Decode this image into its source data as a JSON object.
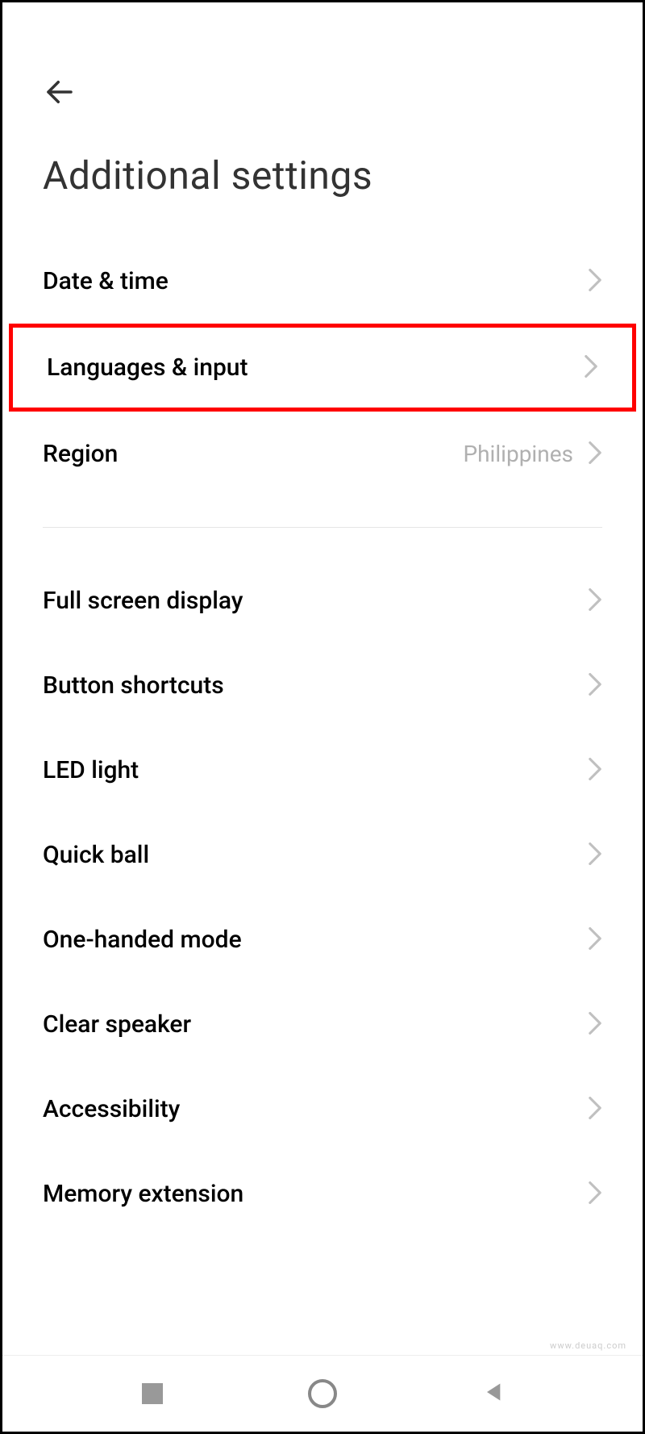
{
  "header": {
    "title": "Additional settings"
  },
  "items": [
    {
      "label": "Date & time",
      "value": "",
      "highlighted": false
    },
    {
      "label": "Languages & input",
      "value": "",
      "highlighted": true
    },
    {
      "label": "Region",
      "value": "Philippines",
      "highlighted": false
    }
  ],
  "items2": [
    {
      "label": "Full screen display"
    },
    {
      "label": "Button shortcuts"
    },
    {
      "label": "LED light"
    },
    {
      "label": "Quick ball"
    },
    {
      "label": "One-handed mode"
    },
    {
      "label": "Clear speaker"
    },
    {
      "label": "Accessibility"
    },
    {
      "label": "Memory extension"
    }
  ],
  "watermark": "www.deuaq.com"
}
